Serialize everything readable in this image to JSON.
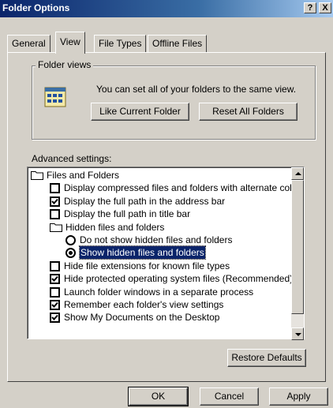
{
  "window": {
    "title": "Folder Options",
    "help_label": "?",
    "close_label": "X"
  },
  "tabs": [
    {
      "label": "General",
      "active": false
    },
    {
      "label": "View",
      "active": true
    },
    {
      "label": "File Types",
      "active": false
    },
    {
      "label": "Offline Files",
      "active": false
    }
  ],
  "folder_views": {
    "legend": "Folder views",
    "description": "You can set all of your folders to the same view.",
    "like_current_label": "Like Current Folder",
    "reset_all_label": "Reset All Folders"
  },
  "advanced": {
    "label": "Advanced settings:",
    "items": [
      {
        "type": "folder",
        "label": "Files and Folders",
        "checked": false
      },
      {
        "type": "checkbox",
        "label": "Display compressed files and folders with alternate color",
        "checked": false
      },
      {
        "type": "checkbox",
        "label": "Display the full path in the address bar",
        "checked": true
      },
      {
        "type": "checkbox",
        "label": "Display the full path in title bar",
        "checked": false
      },
      {
        "type": "folder",
        "label": "Hidden files and folders",
        "checked": false
      },
      {
        "type": "radio",
        "label": "Do not show hidden files and folders",
        "checked": false
      },
      {
        "type": "radio",
        "label": "Show hidden files and folders",
        "checked": true,
        "selected": true
      },
      {
        "type": "checkbox",
        "label": "Hide file extensions for known file types",
        "checked": false
      },
      {
        "type": "checkbox",
        "label": "Hide protected operating system files (Recommended)",
        "checked": true
      },
      {
        "type": "checkbox",
        "label": "Launch folder windows in a separate process",
        "checked": false
      },
      {
        "type": "checkbox",
        "label": "Remember each folder's view settings",
        "checked": true
      },
      {
        "type": "checkbox",
        "label": "Show My Documents on the Desktop",
        "checked": true
      }
    ]
  },
  "restore_defaults_label": "Restore Defaults",
  "footer": {
    "ok_label": "OK",
    "cancel_label": "Cancel",
    "apply_label": "Apply"
  }
}
